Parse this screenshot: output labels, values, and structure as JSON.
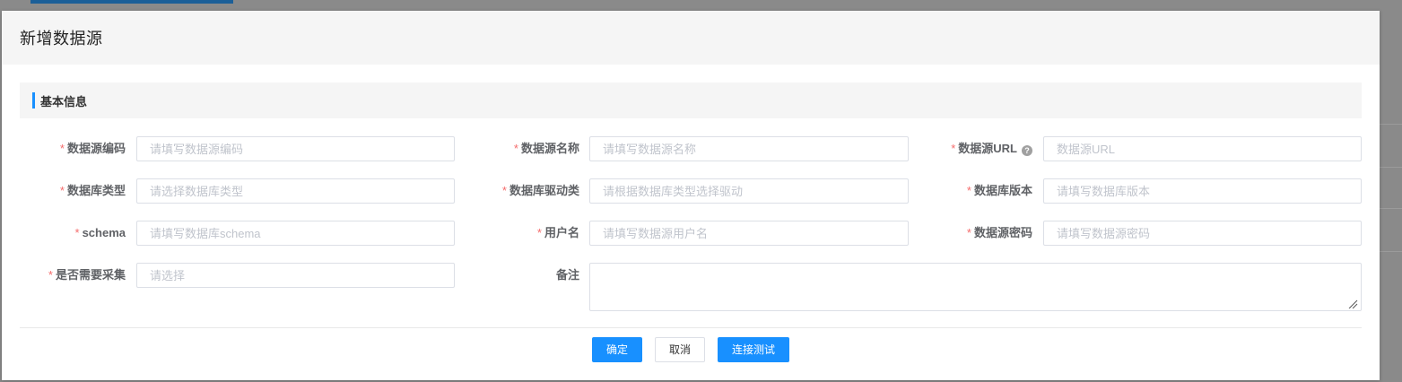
{
  "modal": {
    "title": "新增数据源"
  },
  "section": {
    "title": "基本信息"
  },
  "form": {
    "fields": [
      {
        "label": "数据源编码",
        "required": true,
        "placeholder": "请填写数据源编码"
      },
      {
        "label": "数据源名称",
        "required": true,
        "placeholder": "请填写数据源名称"
      },
      {
        "label": "数据源URL",
        "required": true,
        "placeholder": "数据源URL",
        "help_icon": "question-circle-icon"
      },
      {
        "label": "数据库类型",
        "required": true,
        "placeholder": "请选择数据库类型"
      },
      {
        "label": "数据库驱动类",
        "required": true,
        "placeholder": "请根据数据库类型选择驱动"
      },
      {
        "label": "数据库版本",
        "required": true,
        "placeholder": "请填写数据库版本"
      },
      {
        "label": "schema",
        "required": true,
        "placeholder": "请填写数据库schema"
      },
      {
        "label": "用户名",
        "required": true,
        "placeholder": "请填写数据源用户名"
      },
      {
        "label": "数据源密码",
        "required": true,
        "placeholder": "请填写数据源密码"
      },
      {
        "label": "是否需要采集",
        "required": true,
        "placeholder": "请选择"
      },
      {
        "label": "备注",
        "required": false,
        "placeholder": ""
      }
    ],
    "required_mark": "*",
    "help_glyph": "?"
  },
  "footer": {
    "confirm_label": "确定",
    "cancel_label": "取消",
    "test_label": "连接测试"
  },
  "colors": {
    "primary": "#1890ff",
    "required": "#f56c6c",
    "header_bg": "#f5f5f5"
  }
}
